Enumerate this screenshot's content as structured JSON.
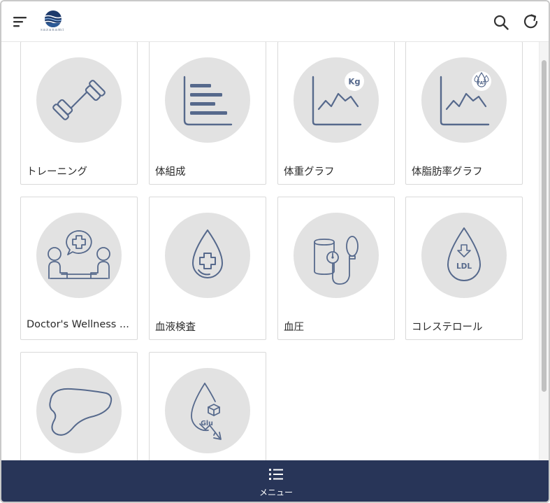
{
  "header": {
    "logo_text": "sazanami",
    "icons": [
      "hamburger-icon",
      "app-logo",
      "search-icon",
      "refresh-icon"
    ]
  },
  "tiles": [
    {
      "label": "トレーニング",
      "icon": "dumbbell-icon"
    },
    {
      "label": "体組成",
      "icon": "body-composition-chart-icon"
    },
    {
      "label": "体重グラフ",
      "icon": "weight-graph-icon",
      "badge": "Kg"
    },
    {
      "label": "体脂肪率グラフ",
      "icon": "body-fat-graph-icon",
      "badge": "FAT"
    },
    {
      "label": "Doctor's Wellness ...",
      "icon": "doctor-consultation-icon"
    },
    {
      "label": "血液検査",
      "icon": "blood-test-icon"
    },
    {
      "label": "血圧",
      "icon": "blood-pressure-icon"
    },
    {
      "label": "コレステロール",
      "icon": "cholesterol-icon",
      "badge": "LDL"
    },
    {
      "label": "",
      "icon": "liver-icon"
    },
    {
      "label": "",
      "icon": "glucose-icon",
      "badge": "Glu"
    }
  ],
  "bottom_nav": {
    "label": "メニュー",
    "icon": "list-icon"
  },
  "colors": {
    "accent": "#283558",
    "icon_stroke": "#56698c",
    "circle_bg": "#e2e2e2"
  }
}
